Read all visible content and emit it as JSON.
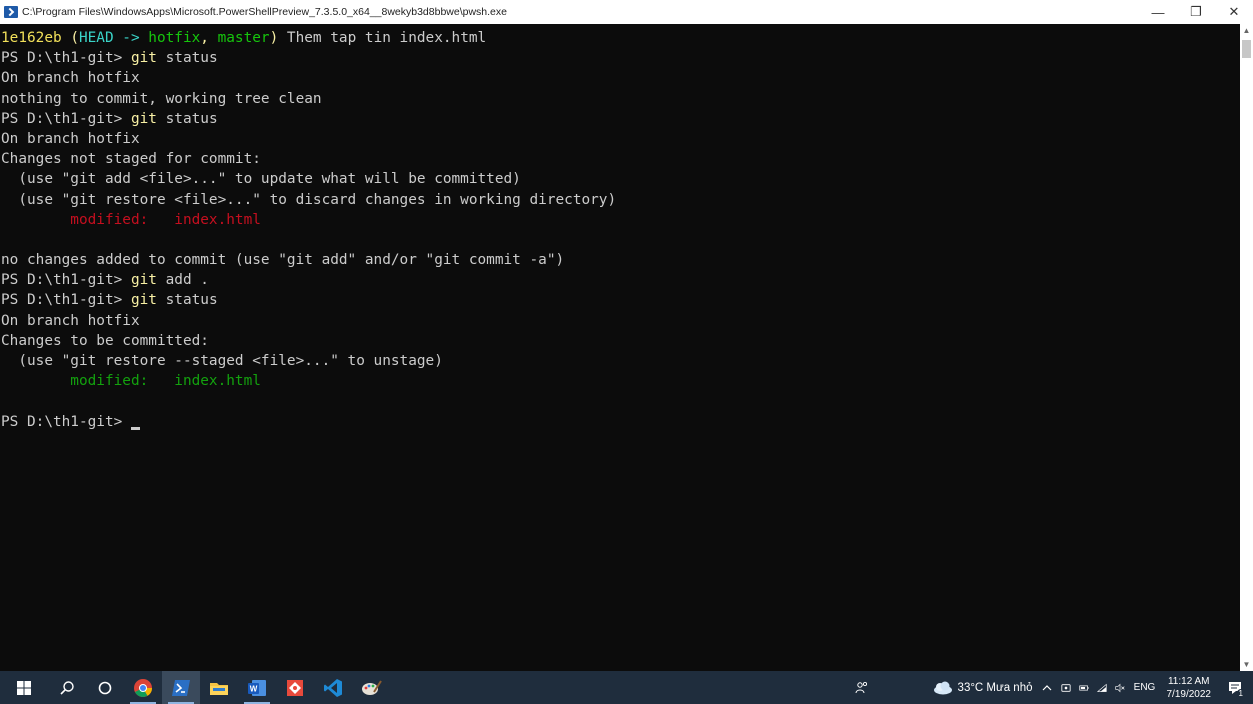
{
  "window": {
    "title": "C:\\Program Files\\WindowsApps\\Microsoft.PowerShellPreview_7.3.5.0_x64__8wekyb3d8bbwe\\pwsh.exe",
    "minimize": "—",
    "maximize": "❐",
    "close": "✕"
  },
  "terminal": {
    "lines": [
      {
        "segments": [
          {
            "text": "1e162eb",
            "color": "hash"
          },
          {
            "text": " (",
            "color": "yellow"
          },
          {
            "text": "HEAD -> ",
            "color": "cyan"
          },
          {
            "text": "hotfix",
            "color": "green"
          },
          {
            "text": ", ",
            "color": "yellow"
          },
          {
            "text": "master",
            "color": "green"
          },
          {
            "text": ")",
            "color": "yellow"
          },
          {
            "text": " Them tap tin index.html",
            "color": "default"
          }
        ]
      },
      {
        "segments": [
          {
            "text": "PS D:\\th1-git> ",
            "color": "default"
          },
          {
            "text": "git",
            "color": "cmd"
          },
          {
            "text": " status",
            "color": "default"
          }
        ]
      },
      {
        "segments": [
          {
            "text": "On branch hotfix",
            "color": "default"
          }
        ]
      },
      {
        "segments": [
          {
            "text": "nothing to commit, working tree clean",
            "color": "default"
          }
        ]
      },
      {
        "segments": [
          {
            "text": "PS D:\\th1-git> ",
            "color": "default"
          },
          {
            "text": "git",
            "color": "cmd"
          },
          {
            "text": " status",
            "color": "default"
          }
        ]
      },
      {
        "segments": [
          {
            "text": "On branch hotfix",
            "color": "default"
          }
        ]
      },
      {
        "segments": [
          {
            "text": "Changes not staged for commit:",
            "color": "default"
          }
        ]
      },
      {
        "segments": [
          {
            "text": "  (use \"git add <file>...\" to update what will be committed)",
            "color": "default"
          }
        ]
      },
      {
        "segments": [
          {
            "text": "  (use \"git restore <file>...\" to discard changes in working directory)",
            "color": "default"
          }
        ]
      },
      {
        "segments": [
          {
            "text": "        modified:   index.html",
            "color": "red"
          }
        ]
      },
      {
        "segments": [
          {
            "text": "",
            "color": "default"
          }
        ]
      },
      {
        "segments": [
          {
            "text": "no changes added to commit (use \"git add\" and/or \"git commit -a\")",
            "color": "default"
          }
        ]
      },
      {
        "segments": [
          {
            "text": "PS D:\\th1-git> ",
            "color": "default"
          },
          {
            "text": "git",
            "color": "cmd"
          },
          {
            "text": " add .",
            "color": "default"
          }
        ]
      },
      {
        "segments": [
          {
            "text": "PS D:\\th1-git> ",
            "color": "default"
          },
          {
            "text": "git",
            "color": "cmd"
          },
          {
            "text": " status",
            "color": "default"
          }
        ]
      },
      {
        "segments": [
          {
            "text": "On branch hotfix",
            "color": "default"
          }
        ]
      },
      {
        "segments": [
          {
            "text": "Changes to be committed:",
            "color": "default"
          }
        ]
      },
      {
        "segments": [
          {
            "text": "  (use \"git restore --staged <file>...\" to unstage)",
            "color": "default"
          }
        ]
      },
      {
        "segments": [
          {
            "text": "        modified:   index.html",
            "color": "gitgreen"
          }
        ]
      },
      {
        "segments": [
          {
            "text": "",
            "color": "default"
          }
        ]
      },
      {
        "segments": [
          {
            "text": "PS D:\\th1-git> ",
            "color": "default"
          }
        ],
        "cursor": true
      }
    ]
  },
  "colors": {
    "default": "#cccccc",
    "hash": "#f1e05a",
    "yellow": "#f9f1a5",
    "cyan": "#3ad4c8",
    "green": "#16c60c",
    "red": "#c50f1f",
    "gitgreen": "#13a10e",
    "cmd": "#f9f1a5"
  },
  "taskbar": {
    "apps": [
      {
        "name": "windows-start-icon",
        "active": false,
        "underline": false
      },
      {
        "name": "search-icon",
        "active": false,
        "underline": false
      },
      {
        "name": "cortana-icon",
        "active": false,
        "underline": false
      },
      {
        "name": "chrome-icon",
        "active": false,
        "underline": true
      },
      {
        "name": "powershell-icon",
        "active": true,
        "underline": true
      },
      {
        "name": "file-explorer-icon",
        "active": false,
        "underline": false
      },
      {
        "name": "word-icon",
        "active": false,
        "underline": true
      },
      {
        "name": "git-gui-icon",
        "active": false,
        "underline": false
      },
      {
        "name": "vscode-icon",
        "active": false,
        "underline": false
      },
      {
        "name": "paint-icon",
        "active": false,
        "underline": false
      }
    ],
    "tray": {
      "people": "ጰ",
      "weather_text": "33°C  Mưa nhỏ",
      "chevron": "^",
      "language": "ENG",
      "time": "11:12 AM",
      "date": "7/19/2022",
      "notification_count": "1"
    }
  }
}
